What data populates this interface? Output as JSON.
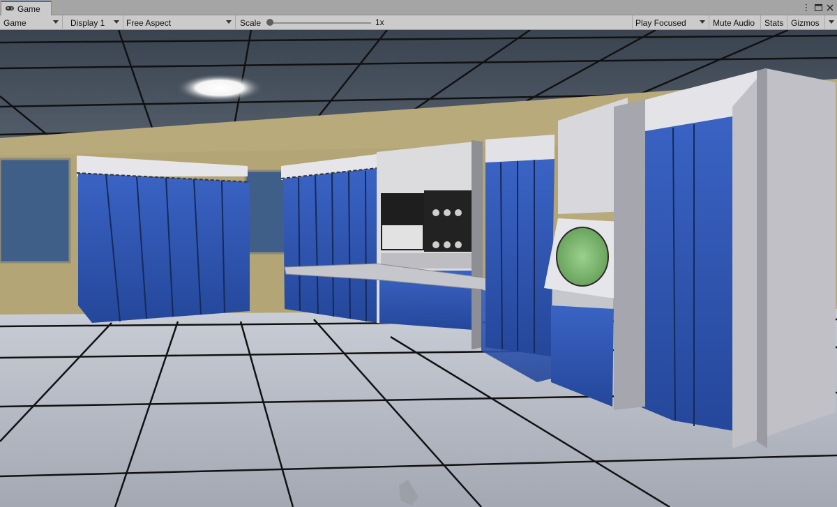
{
  "window": {
    "tab_label": "Game",
    "tab_icon": "gamepad-icon"
  },
  "toolbar": {
    "view_mode": "Game",
    "display": "Display 1",
    "aspect": "Free Aspect",
    "scale_label": "Scale",
    "scale_value": "1x",
    "scale_fraction": 0.0,
    "play_mode": "Play Focused",
    "mute_audio": "Mute Audio",
    "stats": "Stats",
    "gizmos": "Gizmos"
  },
  "colors": {
    "accent": "#3a72b0",
    "cabinet_blue": "#2f55b0",
    "wall_tan": "#b8aa7a",
    "scope_green": "#86c07a"
  },
  "scene": {
    "description_icon": "3d-game-view"
  }
}
